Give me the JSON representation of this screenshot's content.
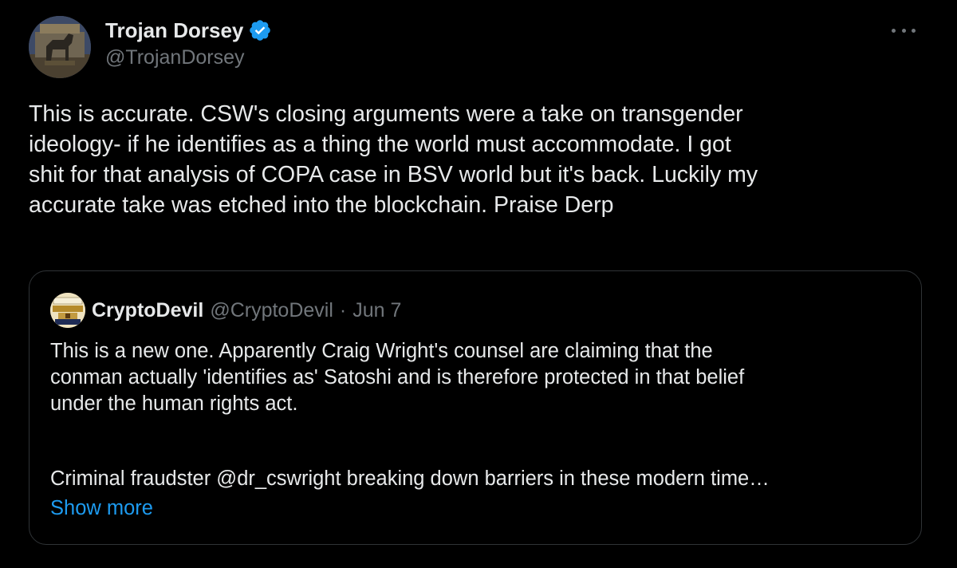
{
  "author": {
    "display_name": "Trojan Dorsey",
    "handle": "@TrojanDorsey",
    "verified": true,
    "avatar_icon": "trojan-horse-statue-icon"
  },
  "tweet": {
    "text": "This is accurate. CSW's closing arguments were a take on transgender\nideology- if he identifies as a thing the world must accommodate.  I got\nshit for that analysis of COPA case in BSV world but it's back. Luckily my\naccurate take was etched into the blockchain. Praise Derp"
  },
  "quoted_tweet": {
    "display_name": "CryptoDevil",
    "handle": "@CryptoDevil",
    "separator": "·",
    "date": "Jun 7",
    "avatar_icon": "grammar-police-badge-icon",
    "text": "This is a new one. Apparently Craig Wright's counsel are claiming that the\nconman actually 'identifies as' Satoshi and is therefore protected in that belief\nunder the human rights act.",
    "text_2": "Criminal fraudster @dr_cswright breaking down barriers in these modern time…",
    "show_more_label": "Show more"
  },
  "colors": {
    "background": "#000000",
    "text": "#e7e9ea",
    "muted": "#71767b",
    "link": "#1d9bf0",
    "border": "#2f3336",
    "verified": "#1d9bf0"
  }
}
